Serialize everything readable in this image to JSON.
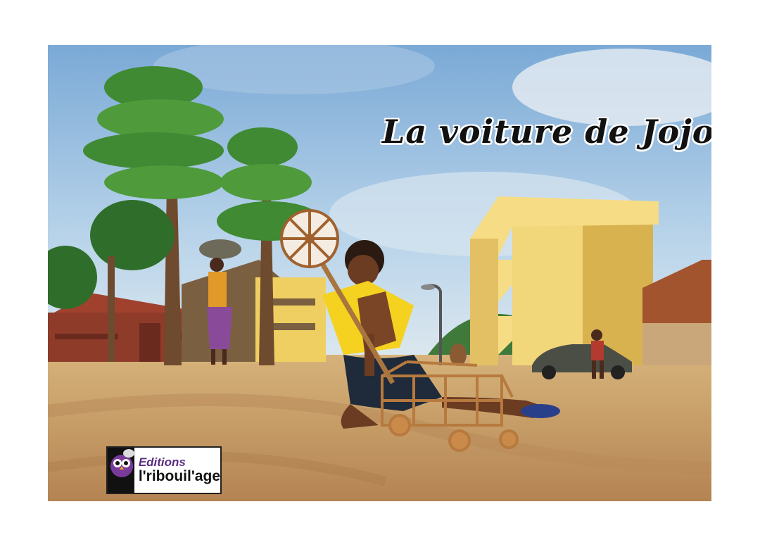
{
  "cover": {
    "title": "La voiture de Jojo",
    "publisher": {
      "line1": "Editions",
      "line2": "l'ribouil'age",
      "logo_icon": "owl-mascot-icon"
    }
  },
  "colors": {
    "sky": "#9fc3e3",
    "ground": "#c9a06a",
    "building_yellow": "#f2d67a",
    "building_red": "#8e3b2a",
    "tree_green": "#3f8a32",
    "boy_shirt": "#f4d21f",
    "brand_purple": "#5a2d82"
  }
}
